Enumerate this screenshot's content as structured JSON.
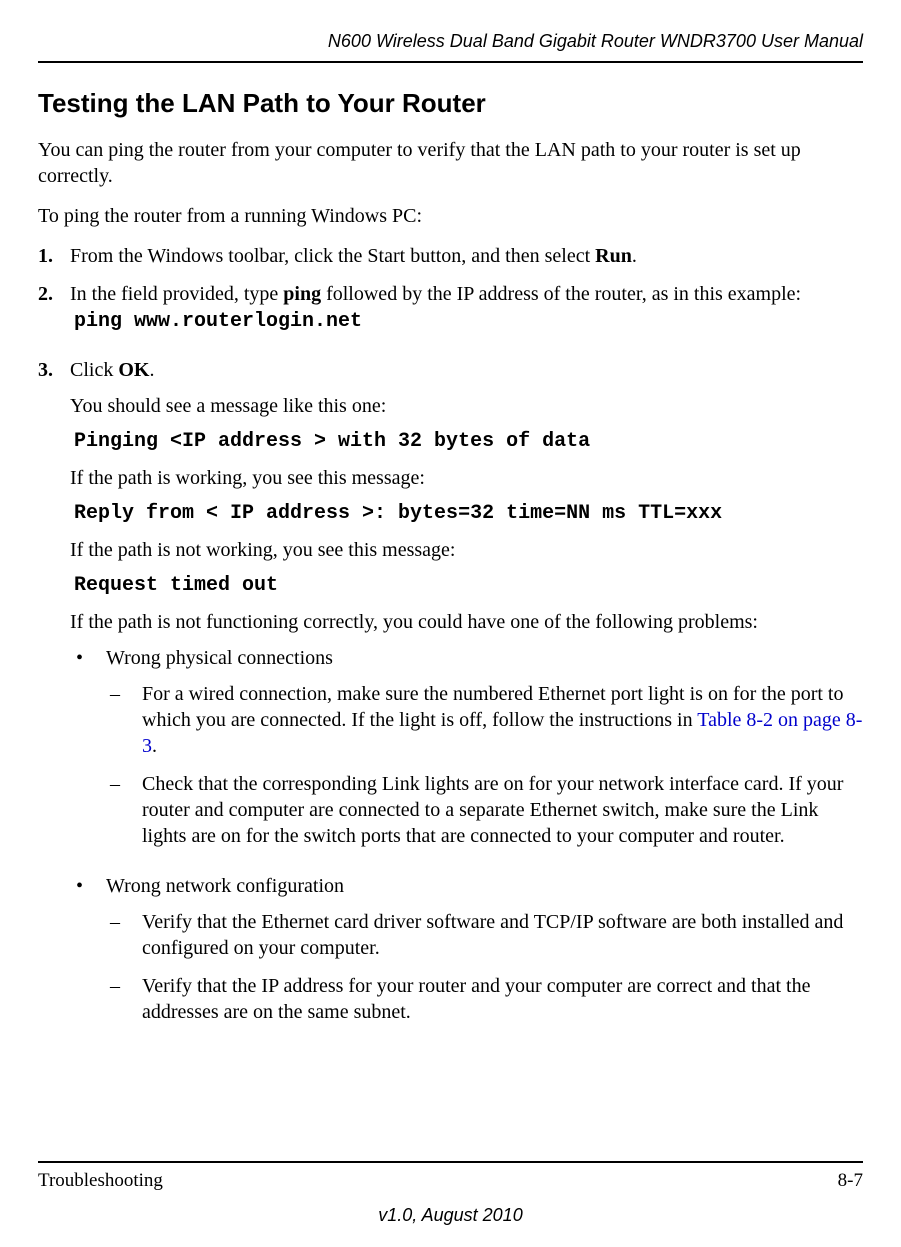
{
  "header": {
    "title": "N600 Wireless Dual Band Gigabit Router WNDR3700 User Manual"
  },
  "section": {
    "heading": "Testing the LAN Path to Your Router",
    "intro": "You can ping the router from your computer to verify that the LAN path to your router is set up correctly.",
    "intro2": "To ping the router from a running Windows PC:"
  },
  "steps": {
    "1": {
      "marker": "1.",
      "text_before": "From the Windows toolbar, click the Start button, and then select ",
      "bold": "Run",
      "text_after": "."
    },
    "2": {
      "marker": "2.",
      "text_before": "In the field provided, type ",
      "bold": "ping",
      "text_after": " followed by the IP address of the router, as in this example:",
      "code": "ping www.routerlogin.net"
    },
    "3": {
      "marker": "3.",
      "text_before": "Click ",
      "bold": "OK",
      "text_after": ".",
      "p1": "You should see a message like this one:",
      "code1": "Pinging <IP address > with 32 bytes of data",
      "p2": "If the path is working, you see this message:",
      "code2": "Reply from < IP address >: bytes=32 time=NN ms TTL=xxx",
      "p3": "If the path is not working, you see this message:",
      "code3": "Request timed out",
      "p4": "If the path is not functioning correctly, you could have one of the following problems:"
    }
  },
  "bullets": {
    "b1": {
      "marker": "•",
      "text": "Wrong physical connections",
      "d1": {
        "marker": "–",
        "text_before": "For a wired connection, make sure the numbered Ethernet port light is on for the port to which you are connected. If the light is off, follow the instructions in ",
        "link": "Table 8-2 on page 8-3",
        "text_after": "."
      },
      "d2": {
        "marker": "–",
        "text": "Check that the corresponding Link lights are on for your network interface card. If your router and computer are connected to a separate Ethernet switch, make sure the Link lights are on for the switch ports that are connected to your computer and router."
      }
    },
    "b2": {
      "marker": "•",
      "text": "Wrong network configuration",
      "d1": {
        "marker": "–",
        "text": "Verify that the Ethernet card driver software and TCP/IP software are both installed and configured on your computer."
      },
      "d2": {
        "marker": "–",
        "text": "Verify that the IP address for your router and your computer are correct and that the addresses are on the same subnet."
      }
    }
  },
  "footer": {
    "left": "Troubleshooting",
    "right": "8-7",
    "version": "v1.0, August 2010"
  }
}
